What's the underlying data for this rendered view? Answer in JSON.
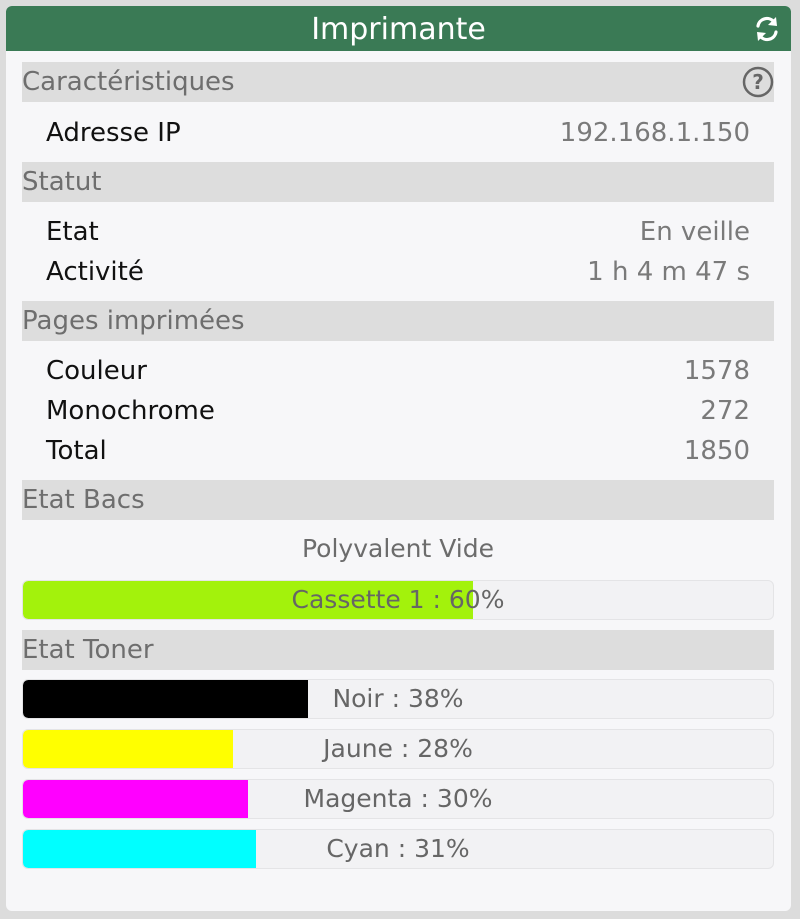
{
  "header": {
    "title": "Imprimante",
    "refresh_icon": "refresh-icon"
  },
  "sections": {
    "characteristics": "Caractéristiques",
    "status": "Statut",
    "pages": "Pages imprimées",
    "trays": "Etat Bacs",
    "toner": "Etat Toner"
  },
  "characteristics": {
    "ip_label": "Adresse IP",
    "ip_value": "192.168.1.150",
    "help_icon": "help-icon"
  },
  "status": {
    "state_label": "Etat",
    "state_value": "En veille",
    "activity_label": "Activité",
    "activity_value": "1 h 4 m 47 s"
  },
  "pages": {
    "color_label": "Couleur",
    "color_value": "1578",
    "mono_label": "Monochrome",
    "mono_value": "272",
    "total_label": "Total",
    "total_value": "1850"
  },
  "trays": {
    "multipurpose": "Polyvalent Vide",
    "cassette": {
      "label": "Cassette 1 : 60%",
      "percent": 60,
      "color": "#a3f20c"
    }
  },
  "toner": [
    {
      "label": "Noir : 38%",
      "percent": 38,
      "color": "#000000"
    },
    {
      "label": "Jaune : 28%",
      "percent": 28,
      "color": "#ffff00"
    },
    {
      "label": "Magenta : 30%",
      "percent": 30,
      "color": "#ff00ff"
    },
    {
      "label": "Cyan : 31%",
      "percent": 31,
      "color": "#00ffff"
    }
  ],
  "colors": {
    "header_bg": "#3a7a55",
    "section_bg": "#dddddd",
    "card_bg": "#f7f7f9"
  }
}
